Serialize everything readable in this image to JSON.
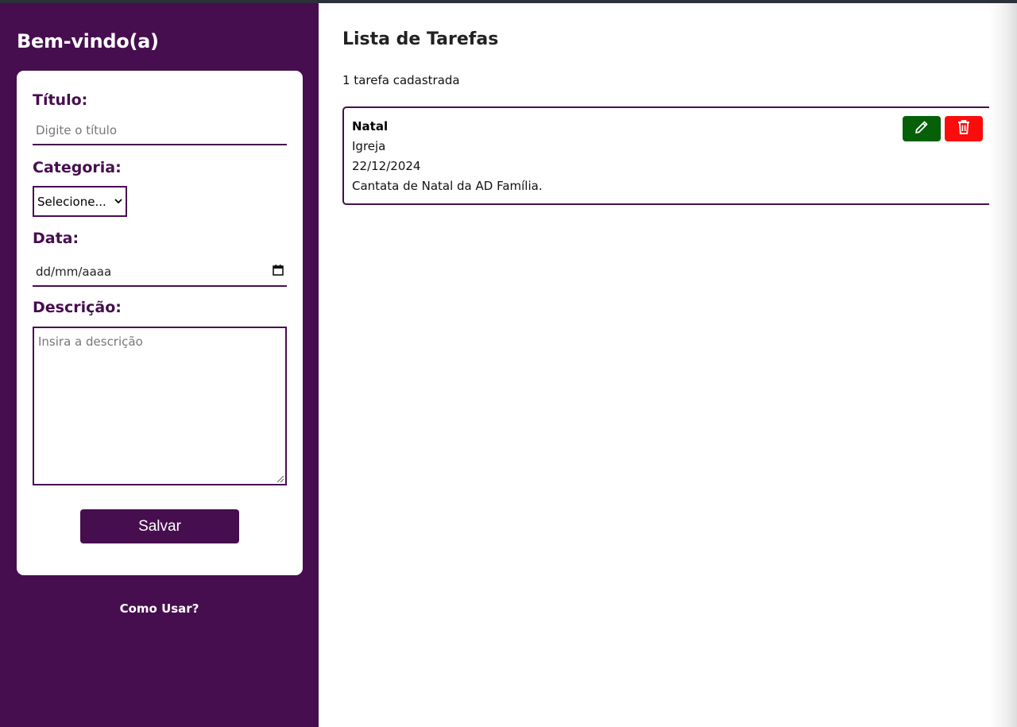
{
  "sidebar": {
    "welcome": "Bem-vindo(a)",
    "help_link": "Como Usar?"
  },
  "form": {
    "title_label": "Título:",
    "title_placeholder": "Digite o título",
    "category_label": "Categoria:",
    "category_selected": "Selecione...",
    "date_label": "Data:",
    "date_value": "dd/mm/aaaa",
    "description_label": "Descrição:",
    "description_placeholder": "Insira a descrição",
    "save_label": "Salvar"
  },
  "main": {
    "title": "Lista de Tarefas",
    "count_text": "1 tarefa cadastrada",
    "tasks": [
      {
        "title": "Natal",
        "category": "Igreja",
        "date": "22/12/2024",
        "description": "Cantata de Natal da AD Família."
      }
    ]
  },
  "colors": {
    "brand_purple": "#460e4f",
    "edit_green": "#056008",
    "delete_red": "#fb0b0b"
  },
  "icons": {
    "edit": "pencil-icon",
    "delete": "trash-icon",
    "date": "calendar-icon",
    "select": "chevron-down-icon"
  }
}
